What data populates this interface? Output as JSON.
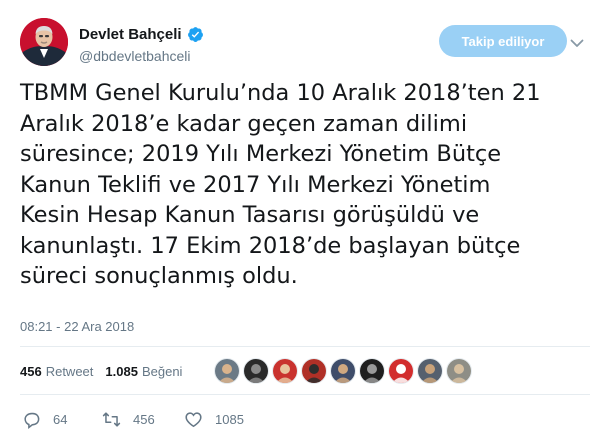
{
  "author": {
    "name": "Devlet Bahçeli",
    "handle": "@dbdevletbahceli",
    "verified": true
  },
  "follow_button": {
    "label": "Takip ediliyor"
  },
  "tweet": {
    "text": "TBMM Genel Kurulu’nda 10 Aralık 2018’ten 21\nAralık 2018’e kadar geçen zaman dilimi\nsüresince; 2019 Yılı Merkezi Yönetim Bütçe\nKanun Teklifi ve 2017 Yılı Merkezi Yönetim\nKesin Hesap Kanun Tasarısı görüşüldü ve\nkanunlaştı. 17 Ekim 2018’de başlayan bütçe\nsüreci sonuçlanmış oldu.",
    "timestamp": "08:21 - 22 Ara 2018"
  },
  "stats": {
    "retweets": {
      "count": "456",
      "label": "Retweet"
    },
    "likes": {
      "count": "1.085",
      "label": "Beğeni"
    }
  },
  "likers": [
    {
      "bg": "#6b7a86",
      "fg": "#d9b38c"
    },
    {
      "bg": "#2a2a2a",
      "fg": "#8a8a8a"
    },
    {
      "bg": "#c9322e",
      "fg": "#e8c39e"
    },
    {
      "bg": "#b03027",
      "fg": "#2d2d2d"
    },
    {
      "bg": "#3f4d6a",
      "fg": "#d0a880"
    },
    {
      "bg": "#1f1f1f",
      "fg": "#9a9a9a"
    },
    {
      "bg": "#d22d2d",
      "fg": "#ffffff"
    },
    {
      "bg": "#55606e",
      "fg": "#c8a27a"
    },
    {
      "bg": "#8e8e86",
      "fg": "#d7c0a0"
    }
  ],
  "actions": {
    "replies": "64",
    "retweets": "456",
    "likes": "1085"
  },
  "colors": {
    "text": "#14171a",
    "muted": "#657786",
    "brand_blue": "#1da1f2",
    "follow_button_bg": "#9ad0f5",
    "divider": "#e6ecf0",
    "avatar_red": "#c8102e"
  },
  "icons": [
    "verified-badge-icon",
    "chevron-down-icon",
    "reply-icon",
    "retweet-icon",
    "like-icon"
  ]
}
